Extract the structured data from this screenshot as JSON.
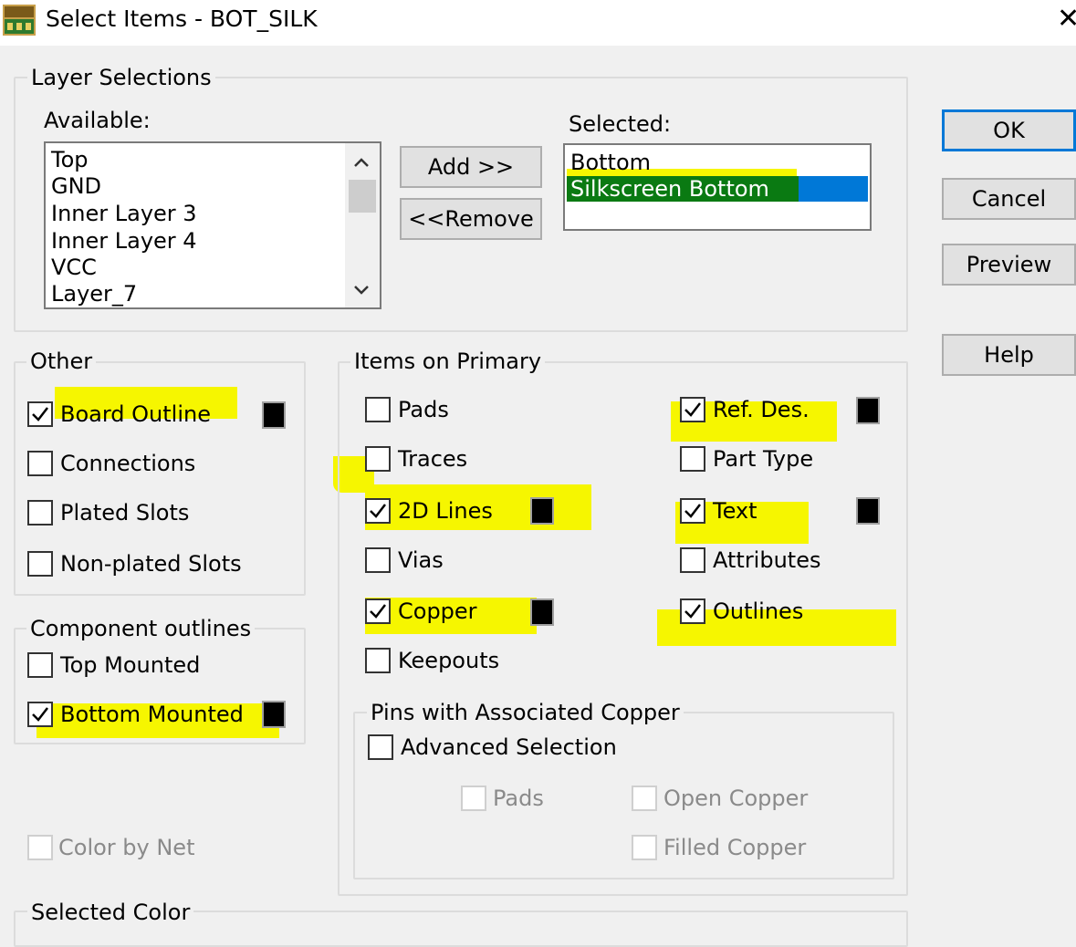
{
  "window": {
    "title": "Select Items - BOT_SILK",
    "close_glyph": "✕",
    "icon": "pads-app-icon"
  },
  "layer_selections": {
    "legend": "Layer Selections",
    "available_label": "Available:",
    "available": [
      "Top",
      "GND",
      "Inner Layer 3",
      "Inner Layer 4",
      "VCC",
      "Layer_7"
    ],
    "selected_label": "Selected:",
    "selected": [
      "Bottom",
      "Silkscreen Bottom"
    ],
    "selected_highlighted": "Silkscreen Bottom",
    "add_label": "Add >>",
    "remove_label": "<<Remove"
  },
  "buttons": {
    "ok": "OK",
    "cancel": "Cancel",
    "preview": "Preview",
    "help": "Help"
  },
  "other": {
    "legend": "Other",
    "items": [
      {
        "label": "Board Outline",
        "checked": true,
        "color": "#000000"
      },
      {
        "label": "Connections",
        "checked": false
      },
      {
        "label": "Plated Slots",
        "checked": false
      },
      {
        "label": "Non-plated Slots",
        "checked": false
      }
    ]
  },
  "component_outlines": {
    "legend": "Component outlines",
    "items": [
      {
        "label": "Top Mounted",
        "checked": false
      },
      {
        "label": "Bottom Mounted",
        "checked": true,
        "color": "#000000"
      }
    ]
  },
  "color_by_net": {
    "label": "Color by Net",
    "checked": false,
    "enabled": false
  },
  "items_on_primary": {
    "legend": "Items on Primary",
    "left": [
      {
        "label": "Pads",
        "checked": false
      },
      {
        "label": "Traces",
        "checked": false
      },
      {
        "label": "2D Lines",
        "checked": true,
        "color": "#000000"
      },
      {
        "label": "Vias",
        "checked": false
      },
      {
        "label": "Copper",
        "checked": true,
        "color": "#000000"
      },
      {
        "label": "Keepouts",
        "checked": false
      }
    ],
    "right": [
      {
        "label": "Ref. Des.",
        "checked": true,
        "color": "#000000"
      },
      {
        "label": "Part Type",
        "checked": false
      },
      {
        "label": "Text",
        "checked": true,
        "color": "#000000"
      },
      {
        "label": "Attributes",
        "checked": false
      },
      {
        "label": "Outlines",
        "checked": true
      }
    ]
  },
  "pins_copper": {
    "legend": "Pins with Associated Copper",
    "advanced": {
      "label": "Advanced Selection",
      "checked": false
    },
    "pads": {
      "label": "Pads",
      "checked": false,
      "enabled": false
    },
    "open_copper": {
      "label": "Open Copper",
      "checked": false,
      "enabled": false
    },
    "filled_copper": {
      "label": "Filled Copper",
      "checked": false,
      "enabled": false
    }
  },
  "selected_color": {
    "legend": "Selected Color"
  },
  "colors": {
    "highlight_marker": "#f6f600",
    "selection_blue": "#0078d7",
    "selection_green": "#0a7a12",
    "default_button_border": "#0078d7"
  }
}
